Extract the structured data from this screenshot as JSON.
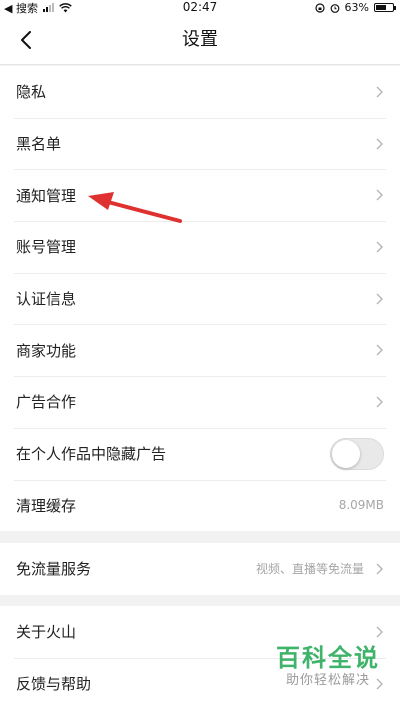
{
  "status_bar": {
    "carrier": "◀ 搜索",
    "time": "02:47",
    "battery": "63%",
    "battery_level": 0.63
  },
  "nav": {
    "title": "设置"
  },
  "groups": [
    {
      "items": [
        {
          "label": "隐私",
          "type": "chevron"
        },
        {
          "label": "黑名单",
          "type": "chevron"
        },
        {
          "label": "通知管理",
          "type": "chevron"
        },
        {
          "label": "账号管理",
          "type": "chevron"
        },
        {
          "label": "认证信息",
          "type": "chevron"
        },
        {
          "label": "商家功能",
          "type": "chevron"
        },
        {
          "label": "广告合作",
          "type": "chevron"
        },
        {
          "label": "在个人作品中隐藏广告",
          "type": "toggle",
          "on": false
        },
        {
          "label": "清理缓存",
          "type": "value",
          "value": "8.09MB"
        }
      ]
    },
    {
      "items": [
        {
          "label": "免流量服务",
          "type": "chevron",
          "value": "视频、直播等免流量"
        }
      ]
    },
    {
      "items": [
        {
          "label": "关于火山",
          "type": "chevron"
        },
        {
          "label": "反馈与帮助",
          "type": "chevron"
        }
      ]
    }
  ],
  "watermark": {
    "title": "百科全说",
    "subtitle": "助你轻松解决"
  },
  "colors": {
    "annotation_arrow": "#e03131",
    "watermark_green": "#3fb36a",
    "chevron": "#b5b5b5"
  }
}
